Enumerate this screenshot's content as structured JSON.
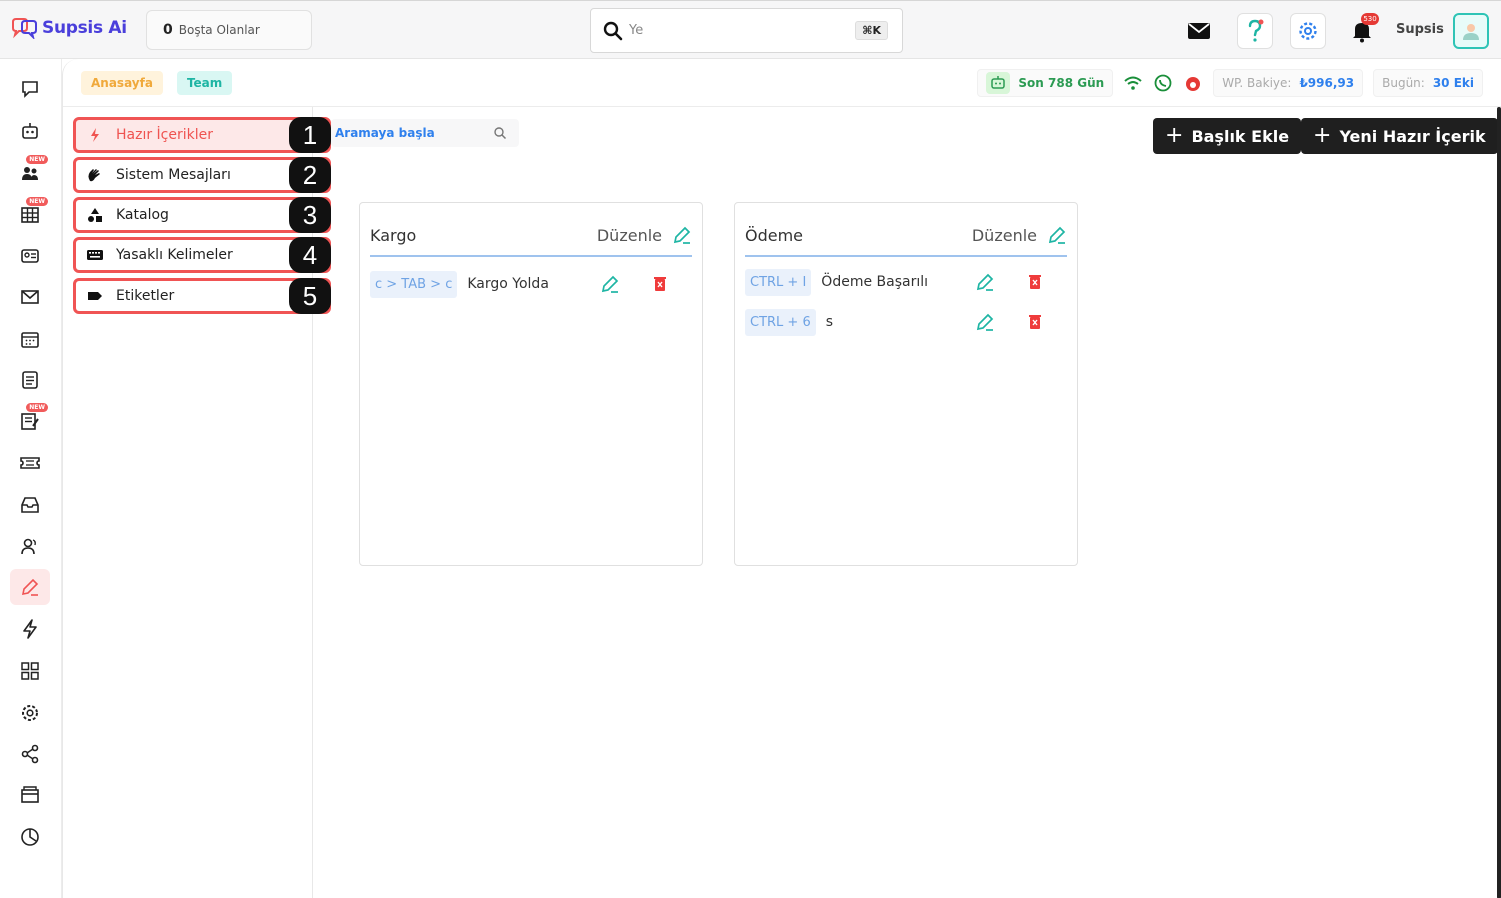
{
  "app": {
    "name": "Supsis Ai"
  },
  "topbar": {
    "idle_count": "0",
    "idle_label": "Boşta Olanlar",
    "search_placeholder": "Ye",
    "search_shortcut": "⌘K",
    "notification_count": "530",
    "user_name": "Supsis"
  },
  "breadcrumbs": [
    "Anasayfa",
    "Team"
  ],
  "stats": {
    "days": "Son 788 Gün",
    "wp_label": "WP. Bakiye:",
    "wp_value": "₺996,93",
    "today_label": "Bugün:",
    "today_value": "30 Eki"
  },
  "rail": {
    "icons": [
      "chat-bubble-icon",
      "robot-icon",
      "team-icon",
      "table-icon",
      "contact-card-icon",
      "mail-icon",
      "calendar-icon",
      "list-icon",
      "notes-icon",
      "ticket-icon",
      "inbox-icon",
      "users-icon",
      "canned-responses-icon",
      "bolt-icon",
      "grid-icon",
      "settings-icon",
      "share-icon",
      "payment-icon",
      "chart-icon"
    ],
    "new_badge": "NEW",
    "active_index": 12
  },
  "menu": {
    "items": [
      {
        "label": "Hazır İçerikler",
        "badge": "1",
        "icon": "bolt-icon",
        "active": true
      },
      {
        "label": "Sistem Mesajları",
        "badge": "2",
        "icon": "wave-hand-icon",
        "active": false
      },
      {
        "label": "Katalog",
        "badge": "3",
        "icon": "shapes-icon",
        "active": false
      },
      {
        "label": "Yasaklı Kelimeler",
        "badge": "4",
        "icon": "keyboard-icon",
        "active": false
      },
      {
        "label": "Etiketler",
        "badge": "5",
        "icon": "tag-icon",
        "active": false
      }
    ]
  },
  "toolbar": {
    "search_placeholder": "Aramaya başla",
    "add_title_label": "Başlık Ekle",
    "add_content_label": "Yeni Hazır İçerik"
  },
  "cards": [
    {
      "title": "Kargo",
      "edit_label": "Düzenle",
      "rows": [
        {
          "shortcut": "c > TAB > c",
          "text": "Kargo Yolda"
        }
      ]
    },
    {
      "title": "Ödeme",
      "edit_label": "Düzenle",
      "rows": [
        {
          "shortcut": "CTRL + I",
          "text": "Ödeme Başarılı"
        },
        {
          "shortcut": "CTRL + 6",
          "text": "s"
        }
      ]
    }
  ],
  "colors": {
    "accent_red": "#f05454",
    "accent_teal": "#1eb5a4",
    "link_blue": "#2f80ed",
    "dark_button": "#1f1f1f"
  }
}
